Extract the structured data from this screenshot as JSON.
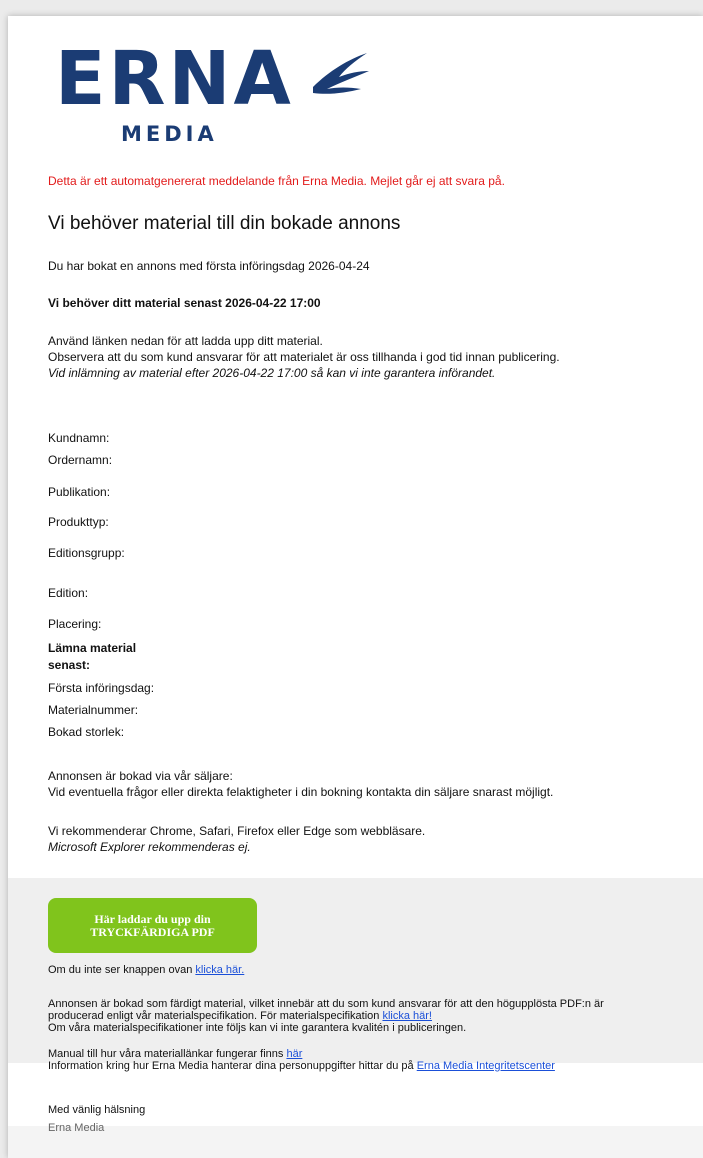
{
  "logo": {
    "name": "ERNA",
    "sub": "MEDIA"
  },
  "notice": "Detta är ett automatgenererat meddelande från Erna Media. Mejlet går ej att svara på.",
  "heading": "Vi behöver material till din bokade annons",
  "booked_line": "Du har bokat en annons med första införingsdag 2026-04-24",
  "deadline_line": "Vi behöver ditt material senast 2026-04-22 17:00",
  "intro": {
    "line1": "Använd länken nedan för att ladda upp ditt material.",
    "line2": "Observera att du som kund ansvarar för att materialet är oss tillhanda i god tid innan publicering.",
    "line3": "Vid inlämning av material efter 2026-04-22 17:00 så kan vi inte garantera införandet."
  },
  "fields": {
    "kundnamn": "Kundnamn:",
    "ordernamn": "Ordernamn:",
    "publikation": "Publikation:",
    "produkttyp": "Produkttyp:",
    "editionsgrupp": "Editionsgrupp:",
    "edition": "Edition:",
    "placering": "Placering:",
    "lamna_1": "Lämna material",
    "lamna_2": "senast:",
    "forsta": "Första införingsdag:",
    "materialnummer": "Materialnummer:",
    "storlek": "Bokad storlek:"
  },
  "seller": {
    "line1": "Annonsen är bokad via vår säljare:",
    "line2": "Vid eventuella frågor eller direkta felaktigheter i din bokning kontakta din säljare snarast möjligt."
  },
  "browser": {
    "line1": "Vi rekommenderar Chrome, Safari, Firefox eller Edge som webbläsare.",
    "line2": "Microsoft Explorer rekommenderas ej."
  },
  "upload_button": {
    "line1": "Här laddar du upp din",
    "line2": "TRYCKFÄRDIGA PDF"
  },
  "fallback": {
    "text": "Om du inte ser knappen ovan ",
    "link": "klicka här."
  },
  "spec": {
    "line1": "Annonsen är bokad som färdigt material, vilket innebär att du som kund ansvarar för att den högupplösta PDF:n är",
    "line2_text": "producerad enligt vår materialspecifikation. För materialspecifikation ",
    "line2_link": "klicka här!",
    "line3": "Om våra materialspecifikationer inte följs kan vi inte garantera kvalitén i publiceringen."
  },
  "manual": {
    "line1_text": "Manual till hur våra materiallänkar fungerar finns ",
    "line1_link": "här",
    "line2_text": "Information kring hur Erna Media hanterar dina personuppgifter hittar du på ",
    "line2_link": "Erna Media Integritetscenter"
  },
  "signoff": {
    "greeting": "Med vänlig hälsning",
    "sender": "Erna Media"
  },
  "colors": {
    "brand": "#1b3c74",
    "notice": "#e21b1b",
    "button": "#80c41c",
    "link": "#1a4fd8"
  }
}
